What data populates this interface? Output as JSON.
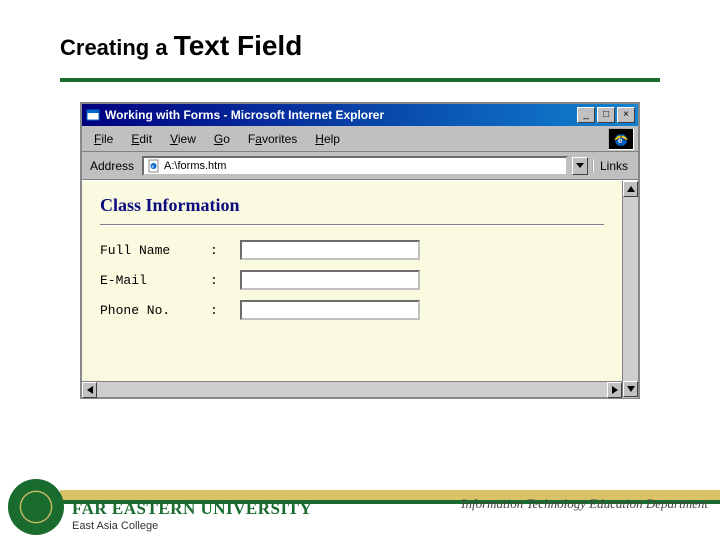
{
  "slide": {
    "title_small": "Creating a ",
    "title_large": "Text Field"
  },
  "window": {
    "title": "Working with Forms - Microsoft Internet Explorer",
    "controls": {
      "min": "_",
      "max": "□",
      "close": "×"
    }
  },
  "menu": {
    "file": "File",
    "edit": "Edit",
    "view": "View",
    "go": "Go",
    "favorites": "Favorites",
    "help": "Help"
  },
  "address": {
    "label": "Address",
    "value": "A:\\forms.htm",
    "links": "Links"
  },
  "page": {
    "heading": "Class Information",
    "fields": {
      "fullname": {
        "label": "Full Name",
        "value": ""
      },
      "email": {
        "label": "E-Mail",
        "value": ""
      },
      "phone": {
        "label": "Phone No.",
        "value": ""
      }
    },
    "colon": ":"
  },
  "footer": {
    "university": "FAR EASTERN UNIVERSITY",
    "college": "East Asia College",
    "department": "Information Technology Education Department"
  }
}
